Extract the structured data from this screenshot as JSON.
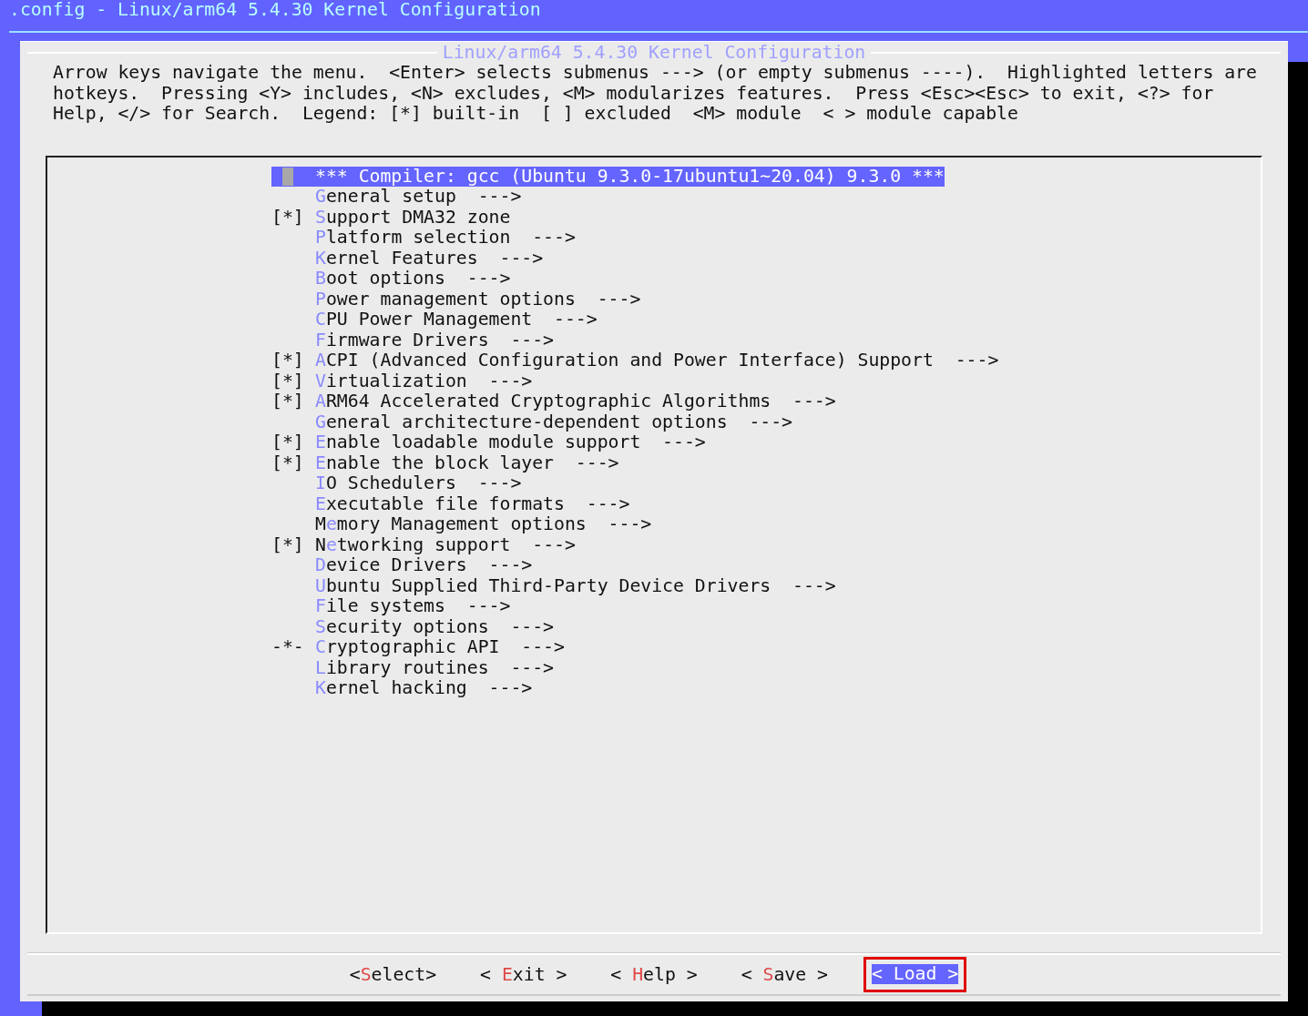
{
  "window": {
    "title": ".config - Linux/arm64 5.4.30 Kernel Configuration"
  },
  "dialog": {
    "title": "Linux/arm64 5.4.30 Kernel Configuration",
    "help": "Arrow keys navigate the menu.  <Enter> selects submenus ---> (or empty submenus ----).  Highlighted letters are\nhotkeys.  Pressing <Y> includes, <N> excludes, <M> modularizes features.  Press <Esc><Esc> to exit, <?> for\nHelp, </> for Search.  Legend: [*] built-in  [ ] excluded  <M> module  < > module capable"
  },
  "menu": {
    "items": [
      {
        "kind": "comment",
        "text": "*** Compiler: gcc (Ubuntu 9.3.0-17ubuntu1~20.04) 9.3.0 ***",
        "selected": true
      },
      {
        "kind": "menu",
        "hotkey": "G",
        "text": "eneral setup",
        "arrow": "--->",
        "selected": false
      },
      {
        "kind": "option",
        "prefix": "[*]",
        "hotkey": "S",
        "text": "upport DMA32 zone",
        "selected": false
      },
      {
        "kind": "menu",
        "hotkey": "P",
        "text": "latform selection",
        "arrow": "--->",
        "selected": false
      },
      {
        "kind": "menu",
        "hotkey": "K",
        "text": "ernel Features",
        "arrow": "--->",
        "selected": false
      },
      {
        "kind": "menu",
        "hotkey": "B",
        "text": "oot options",
        "arrow": "--->",
        "selected": false
      },
      {
        "kind": "menu",
        "hotkey": "P",
        "text": "ower management options",
        "arrow": "--->",
        "selected": false
      },
      {
        "kind": "menu",
        "hotkey": "C",
        "text": "PU Power Management",
        "arrow": "--->",
        "selected": false
      },
      {
        "kind": "menu",
        "hotkey": "F",
        "text": "irmware Drivers",
        "arrow": "--->",
        "selected": false
      },
      {
        "kind": "option",
        "prefix": "[*]",
        "hotkey": "A",
        "text": "CPI (Advanced Configuration and Power Interface) Support",
        "arrow": "--->",
        "selected": false
      },
      {
        "kind": "option",
        "prefix": "[*]",
        "hotkey": "V",
        "text": "irtualization",
        "arrow": "--->",
        "selected": false
      },
      {
        "kind": "option",
        "prefix": "[*]",
        "hotkey": "A",
        "text": "RM64 Accelerated Cryptographic Algorithms",
        "arrow": "--->",
        "selected": false
      },
      {
        "kind": "menu",
        "hotkey": "G",
        "text": "eneral architecture-dependent options",
        "arrow": "--->",
        "selected": false
      },
      {
        "kind": "option",
        "prefix": "[*]",
        "hotkey": "E",
        "text": "nable loadable module support",
        "arrow": "--->",
        "selected": false
      },
      {
        "kind": "option",
        "prefix": "[*]",
        "hotkey": "E",
        "text": "nable the block layer",
        "arrow": "--->",
        "selected": false
      },
      {
        "kind": "menu",
        "hotkey": "I",
        "text": "O Schedulers",
        "arrow": "--->",
        "selected": false
      },
      {
        "kind": "menu",
        "hotkey": "E",
        "text": "xecutable file formats",
        "arrow": "--->",
        "selected": false
      },
      {
        "kind": "menu",
        "lead": "M",
        "hotkey": "e",
        "text": "mory Management options",
        "arrow": "--->",
        "selected": false
      },
      {
        "kind": "option",
        "prefix": "[*]",
        "lead": "N",
        "hotkey": "e",
        "text": "tworking support",
        "arrow": "--->",
        "selected": false
      },
      {
        "kind": "menu",
        "hotkey": "D",
        "text": "evice Drivers",
        "arrow": "--->",
        "selected": false
      },
      {
        "kind": "menu",
        "hotkey": "U",
        "text": "buntu Supplied Third-Party Device Drivers",
        "arrow": "--->",
        "selected": false
      },
      {
        "kind": "menu",
        "hotkey": "F",
        "text": "ile systems",
        "arrow": "--->",
        "selected": false
      },
      {
        "kind": "menu",
        "hotkey": "S",
        "text": "ecurity options",
        "arrow": "--->",
        "selected": false
      },
      {
        "kind": "option",
        "prefix": "-*-",
        "hotkey": "C",
        "text": "ryptographic API",
        "arrow": "--->",
        "selected": false
      },
      {
        "kind": "menu",
        "hotkey": "L",
        "text": "ibrary routines",
        "arrow": "--->",
        "selected": false
      },
      {
        "kind": "menu",
        "hotkey": "K",
        "text": "ernel hacking",
        "arrow": "--->",
        "selected": false
      }
    ]
  },
  "buttons": [
    {
      "lead": "<",
      "hotkey": "S",
      "text": "elect>",
      "selected": false,
      "annotated": false
    },
    {
      "lead": "< ",
      "hotkey": "E",
      "text": "xit >",
      "selected": false,
      "annotated": false
    },
    {
      "lead": "< ",
      "hotkey": "H",
      "text": "elp >",
      "selected": false,
      "annotated": false
    },
    {
      "lead": "< ",
      "hotkey": "S",
      "text": "ave >",
      "selected": false,
      "annotated": false
    },
    {
      "lead": "< ",
      "hotkey": "L",
      "text": "oad >",
      "selected": true,
      "annotated": true
    }
  ]
}
